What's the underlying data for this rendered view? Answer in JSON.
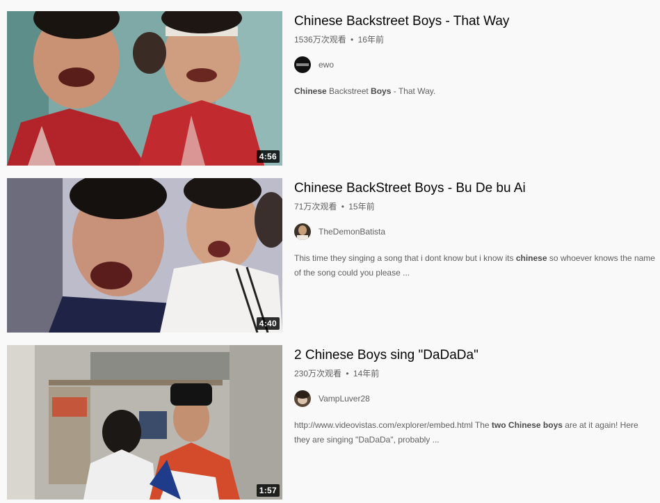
{
  "videos": [
    {
      "title": "Chinese Backstreet Boys - That Way",
      "views": "1536万次观看",
      "separator": "•",
      "age": "16年前",
      "channel": "ewo",
      "duration": "4:56",
      "description": [
        {
          "text": "Chinese",
          "bold": true
        },
        {
          "text": " Backstreet ",
          "bold": false
        },
        {
          "text": "Boys",
          "bold": true
        },
        {
          "text": " - That Way.",
          "bold": false
        }
      ],
      "avatar_color": "#111111"
    },
    {
      "title": "Chinese BackStreet Boys - Bu De bu Ai",
      "views": "71万次观看",
      "separator": "•",
      "age": "15年前",
      "channel": "TheDemonBatista",
      "duration": "4:40",
      "description": [
        {
          "text": "This time they singing a song that i dont know but i know its ",
          "bold": false
        },
        {
          "text": "chinese",
          "bold": true
        },
        {
          "text": " so whoever knows the name of the song could you please ...",
          "bold": false
        }
      ],
      "avatar_color": "#3a3226"
    },
    {
      "title": "2 Chinese Boys sing \"DaDaDa\"",
      "views": "230万次观看",
      "separator": "•",
      "age": "14年前",
      "channel": "VampLuver28",
      "duration": "1:57",
      "description": [
        {
          "text": "http://www.videovistas.com/explorer/embed.html The ",
          "bold": false
        },
        {
          "text": "two Chinese boys",
          "bold": true
        },
        {
          "text": " are at it again! Here they are singing \"DaDaDa\", probably ...",
          "bold": false
        }
      ],
      "avatar_color": "#5a4636"
    }
  ],
  "theme": {
    "background": "#f9f9f9",
    "title_color": "#030303",
    "meta_color": "#606060"
  }
}
